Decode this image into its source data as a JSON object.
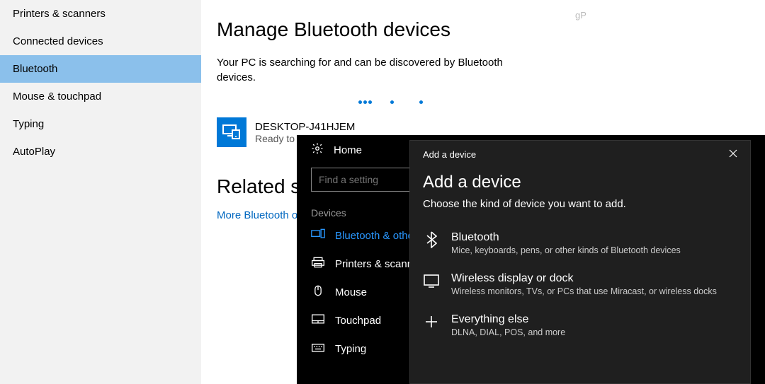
{
  "watermark": "gP",
  "sidebar_left": {
    "items": [
      "Printers & scanners",
      "Connected devices",
      "Bluetooth",
      "Mouse & touchpad",
      "Typing",
      "AutoPlay"
    ],
    "selected_index": 2
  },
  "main": {
    "title": "Manage Bluetooth devices",
    "desc": "Your PC is searching for and can be discovered by Bluetooth devices.",
    "device": {
      "name": "DESKTOP-J41HJEM",
      "status": "Ready to pair"
    },
    "related_heading": "Related sett",
    "link": "More Bluetooth o"
  },
  "dark": {
    "home": "Home",
    "search_placeholder": "Find a setting",
    "section": "Devices",
    "items": [
      "Bluetooth & other devic",
      "Printers & scanners",
      "Mouse",
      "Touchpad",
      "Typing"
    ],
    "active_index": 0
  },
  "dialog": {
    "titlebar": "Add a device",
    "heading": "Add a device",
    "sub": "Choose the kind of device you want to add.",
    "options": [
      {
        "title": "Bluetooth",
        "desc": "Mice, keyboards, pens, or other kinds of Bluetooth devices"
      },
      {
        "title": "Wireless display or dock",
        "desc": "Wireless monitors, TVs, or PCs that use Miracast, or wireless docks"
      },
      {
        "title": "Everything else",
        "desc": "DLNA, DIAL, POS, and more"
      }
    ]
  }
}
